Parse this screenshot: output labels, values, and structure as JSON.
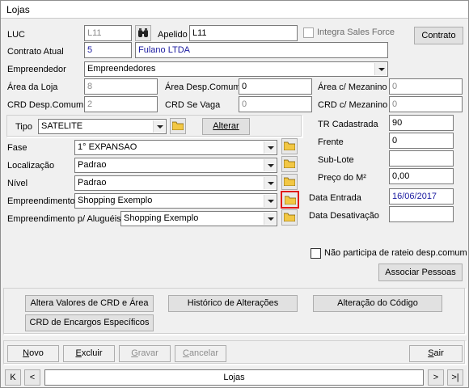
{
  "window": {
    "title": "Lojas"
  },
  "fields": {
    "luc_label": "LUC",
    "luc_value": "L11",
    "apelido_label": "Apelido",
    "apelido_value": "L11",
    "integra_label": "Integra Sales Force",
    "contrato_button": "Contrato",
    "contrato_atual_label": "Contrato Atual",
    "contrato_atual_num": "5",
    "contrato_atual_name": "Fulano LTDA",
    "empreendedor_label": "Empreendedor",
    "empreendedor_value": "Empreendedores",
    "area_loja_label": "Área da Loja",
    "area_loja_value": "8",
    "area_desp_label": "Área Desp.Comum",
    "area_desp_value": "0",
    "area_mez_label": "Área c/ Mezanino",
    "area_mez_value": "0",
    "crd_desp_label": "CRD Desp.Comum",
    "crd_desp_value": "2",
    "crd_vaga_label": "CRD Se Vaga",
    "crd_vaga_value": "0",
    "crd_mez_label": "CRD c/ Mezanino",
    "crd_mez_value": "0",
    "tipo_label": "Tipo",
    "tipo_value": "SATELITE",
    "alterar_button": "Alterar",
    "tr_label": "TR Cadastrada",
    "tr_value": "90",
    "frente_label": "Frente",
    "frente_value": "0",
    "sublote_label": "Sub-Lote",
    "sublote_value": "",
    "preco_label": "Preço do M²",
    "preco_value": "0,00",
    "fase_label": "Fase",
    "fase_value": "1° EXPANSAO",
    "localizacao_label": "Localização",
    "localizacao_value": "Padrao",
    "nivel_label": "Nível",
    "nivel_value": "Padrao",
    "empreendimento_label": "Empreendimento",
    "empreendimento_value": "Shopping Exemplo",
    "empreend_alug_label": "Empreendimento p/ Aluguéis",
    "empreend_alug_value": "Shopping Exemplo",
    "data_entrada_label": "Data Entrada",
    "data_entrada_value": "16/06/2017",
    "data_desativacao_label": "Data Desativação",
    "data_desativacao_value": "",
    "rateio_label": "Não participa de rateio desp.comum",
    "associar_button": "Associar Pessoas"
  },
  "actions": {
    "altera_valores": "Altera Valores de CRD e Área",
    "historico": "Histórico de Alterações",
    "alteracao_codigo": "Alteração do Código",
    "crd_encargos": "CRD de Encargos Específicos"
  },
  "footer": {
    "novo_first": "N",
    "novo_rest": "ovo",
    "excluir_first": "E",
    "excluir_rest": "xcluir",
    "gravar_first": "G",
    "gravar_rest": "ravar",
    "cancelar_first": "C",
    "cancelar_rest": "ancelar",
    "sair_first": "S",
    "sair_rest": "air"
  },
  "navigator": {
    "first": "K",
    "prev": "<",
    "label": "Lojas",
    "next": ">",
    "last": ">|"
  },
  "colors": {
    "highlight": "#e01818",
    "folder": "#f2c744",
    "value_blue": "#1a1aa0"
  },
  "icons": {
    "search": "binoculars-icon",
    "folder": "folder-icon"
  }
}
